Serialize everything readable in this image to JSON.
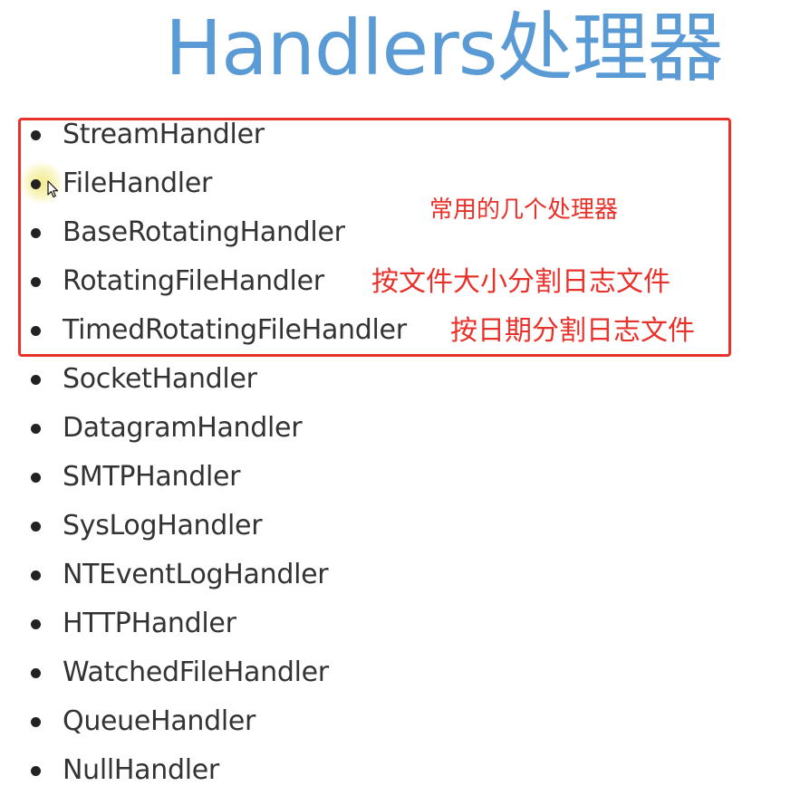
{
  "title": "Handlers处理器",
  "annotations": {
    "common": "常用的几个处理器",
    "rotating_file": "按文件大小分割日志文件",
    "timed_rotating_file": "按日期分割日志文件"
  },
  "handlers": [
    {
      "name": "StreamHandler"
    },
    {
      "name": "FileHandler"
    },
    {
      "name": "BaseRotatingHandler"
    },
    {
      "name": "RotatingFileHandler"
    },
    {
      "name": "TimedRotatingFileHandler"
    },
    {
      "name": "SocketHandler"
    },
    {
      "name": "DatagramHandler"
    },
    {
      "name": "SMTPHandler"
    },
    {
      "name": "SysLogHandler"
    },
    {
      "name": "NTEventLogHandler"
    },
    {
      "name": "HTTPHandler"
    },
    {
      "name": "WatchedFileHandler"
    },
    {
      "name": "QueueHandler"
    },
    {
      "name": "NullHandler"
    }
  ],
  "colors": {
    "title": "#5b9bd5",
    "highlight": "#e8312a",
    "text": "#333333"
  }
}
